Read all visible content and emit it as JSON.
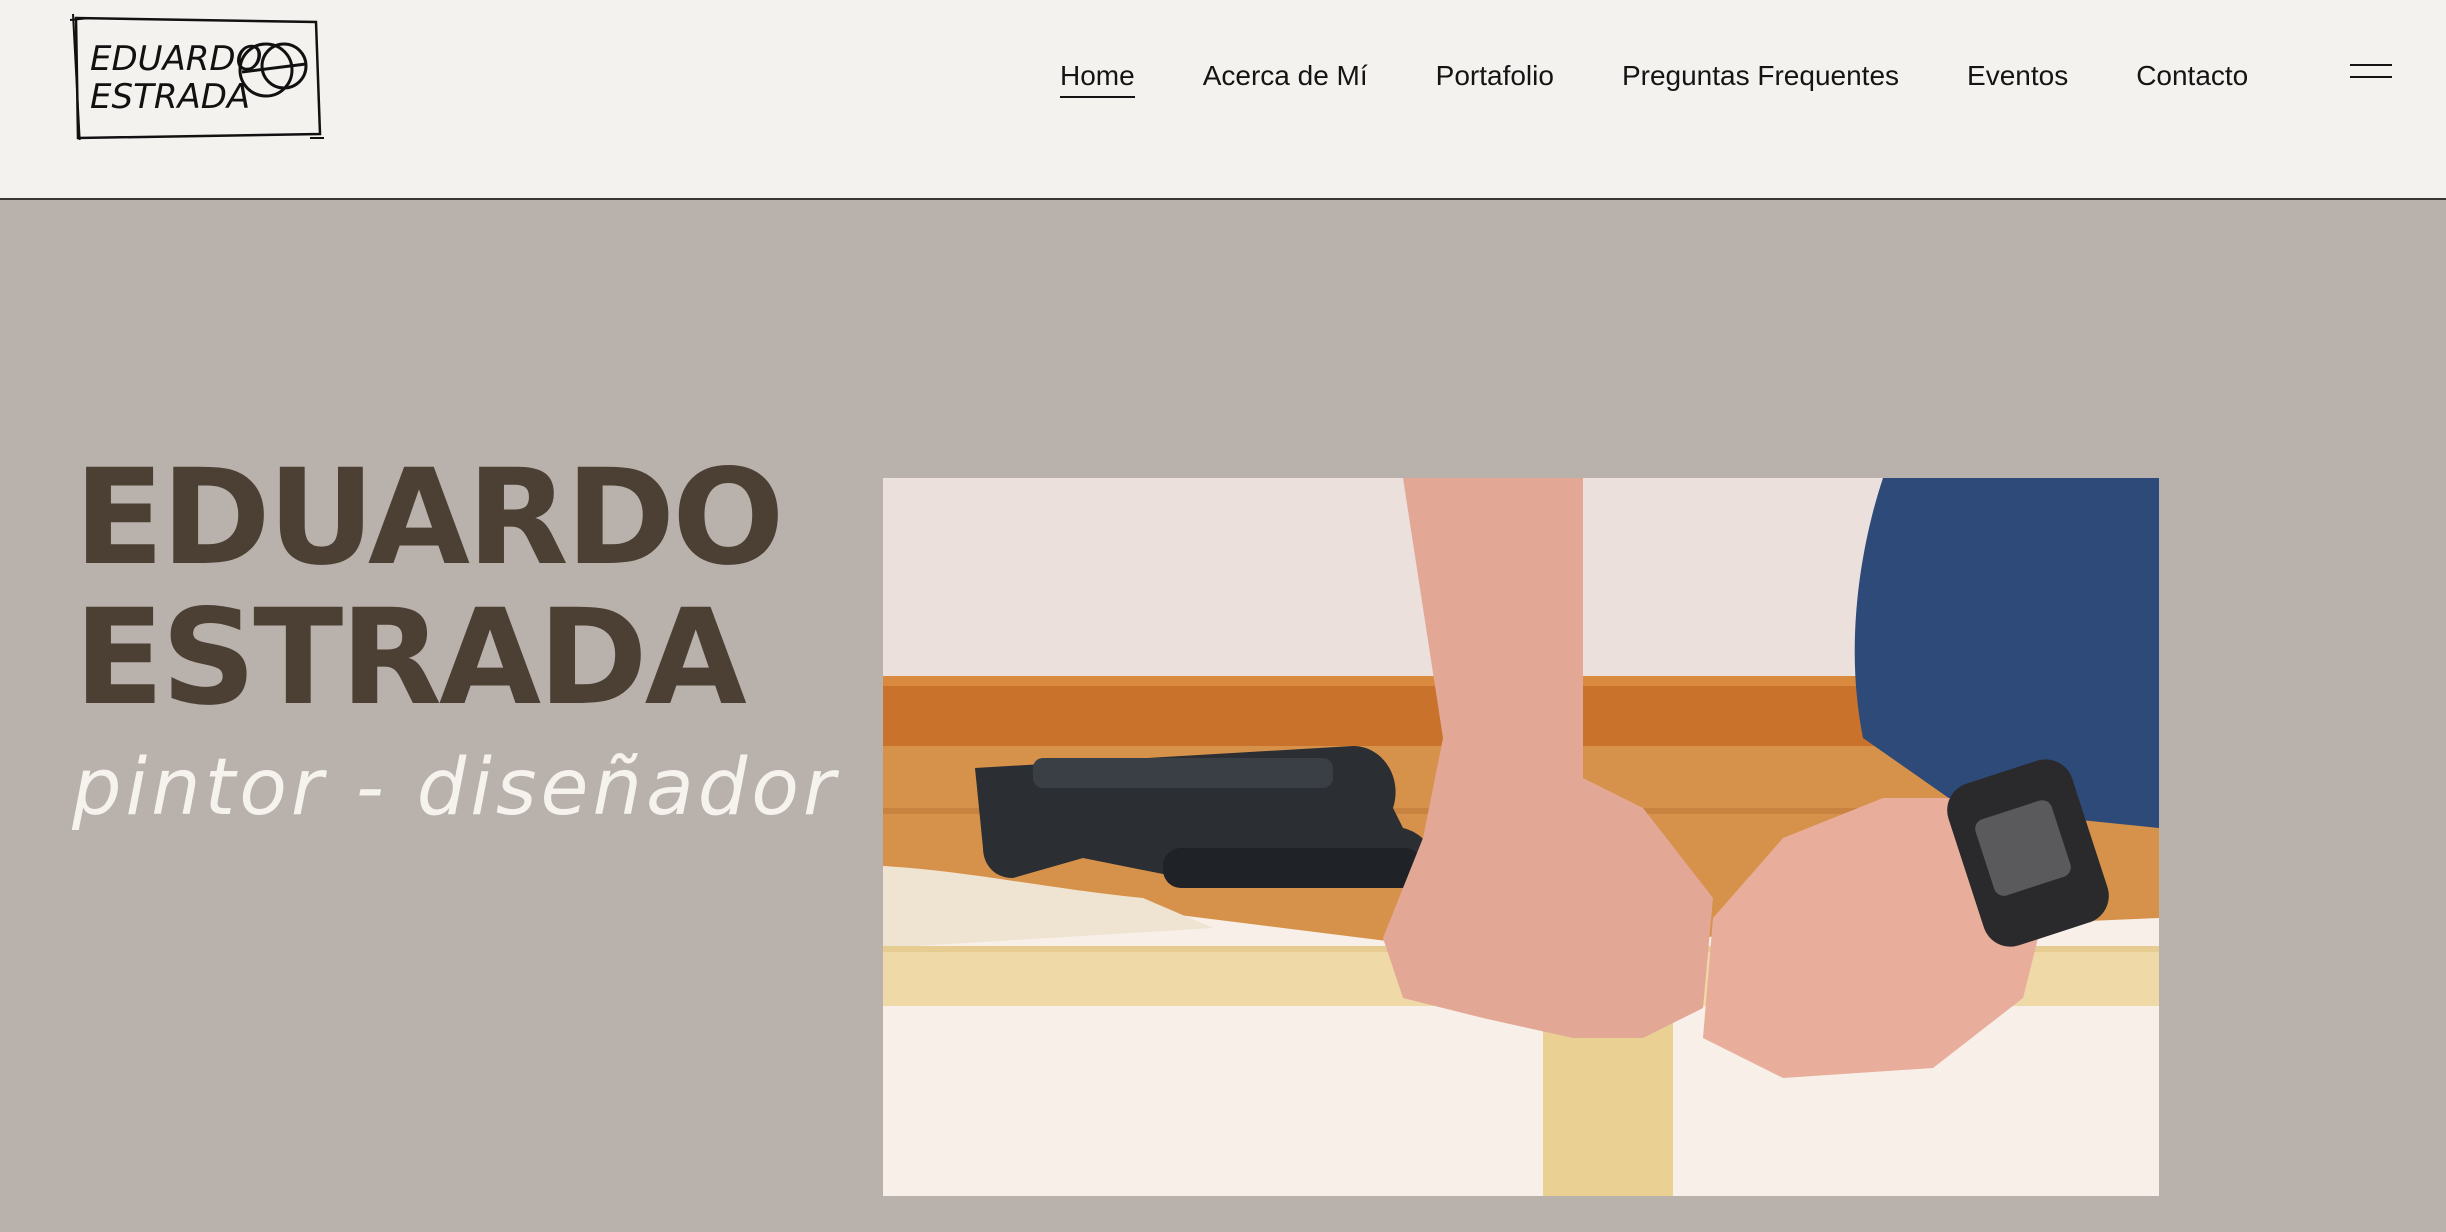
{
  "header": {
    "logo": {
      "line1": "EDUARDO",
      "line2": "ESTRADA"
    },
    "nav": {
      "items": [
        {
          "label": "Home",
          "active": true
        },
        {
          "label": "Acerca de Mí",
          "active": false
        },
        {
          "label": "Portafolio",
          "active": false
        },
        {
          "label": "Preguntas Frequentes",
          "active": false
        },
        {
          "label": "Eventos",
          "active": false
        },
        {
          "label": "Contacto",
          "active": false
        }
      ],
      "menu_icon": "hamburger-menu-icon"
    }
  },
  "hero": {
    "name_line1": "EDUARDO",
    "name_line2": "ESTRADA",
    "subtitle": "pintor - diseñador",
    "media_icon": "video-still-hands-stretching-canvas"
  },
  "colors": {
    "header_bg": "#f4f2ee",
    "page_bg": "#b9b1ab",
    "name_color": "#4c3f33",
    "subtitle_color": "#f6f2ee",
    "nav_text": "#141414"
  }
}
